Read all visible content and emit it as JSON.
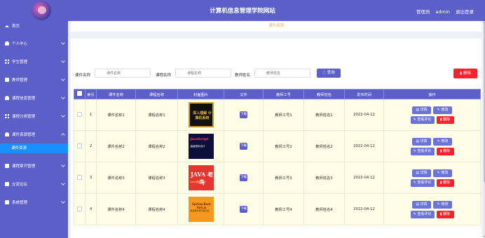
{
  "header": {
    "title": "计算机信息管理学院网站",
    "user_role": "管理员",
    "user_name": "admin",
    "logout": "退出登录"
  },
  "sidebar": {
    "items": [
      {
        "label": "首页",
        "icon": "home-icon"
      },
      {
        "label": "个人中心",
        "icon": "user-icon"
      },
      {
        "label": "学生管理",
        "icon": "grid-icon"
      },
      {
        "label": "教师管理",
        "icon": "box-icon"
      },
      {
        "label": "课程信息管理",
        "icon": "user-icon"
      },
      {
        "label": "课程分类管理",
        "icon": "grid-icon"
      },
      {
        "label": "课件资源管理",
        "icon": "user-icon",
        "expanded": true,
        "children": [
          "课件资源"
        ]
      },
      {
        "label": "课程章节管理",
        "icon": "box-icon"
      },
      {
        "label": "交流论坛",
        "icon": "chat-icon"
      },
      {
        "label": "系统管理",
        "icon": "chat-icon"
      }
    ]
  },
  "breadcrumb": {
    "text": "课件资源"
  },
  "search": {
    "field1_label": "课件名称",
    "field1_placeholder": "课件名称",
    "field2_label": "课程名称",
    "field2_placeholder": "课程名称",
    "field3_label": "教师姓名",
    "field3_placeholder": "教师姓名",
    "search_button": "查询",
    "delete_button": "删除"
  },
  "table": {
    "columns": [
      "索引",
      "课件名称",
      "课程名称",
      "封面图片",
      "文件",
      "教师工号",
      "教师姓名",
      "发布时间",
      "操作"
    ],
    "download_label": "下载",
    "actions": {
      "detail": "详情",
      "edit": "修改",
      "review": "查看评论",
      "delete": "删除"
    },
    "rows": [
      {
        "index": "1",
        "courseware": "课件名称1",
        "course": "课程名称1",
        "teacher_id": "教师工号1",
        "teacher_name": "教师姓名1",
        "date": "2022-04-12",
        "cover_text": "深入理解 计算机系统",
        "cover_sub": ""
      },
      {
        "index": "2",
        "courseware": "课件名称2",
        "course": "课程名称2",
        "teacher_id": "教师工号2",
        "teacher_name": "教师姓名2",
        "date": "2022-04-12",
        "cover_text": "JavaScript",
        "cover_sub": "高级程序设计"
      },
      {
        "index": "3",
        "courseware": "课件名称3",
        "course": "课程名称3",
        "teacher_id": "教师工号3",
        "teacher_name": "教师姓名3",
        "date": "2022-04-12",
        "cover_text": "JAVA 老鸟",
        "cover_sub": "Java 程序设计"
      },
      {
        "index": "4",
        "courseware": "课件名称4",
        "course": "课程名称4",
        "teacher_id": "教师工号4",
        "teacher_name": "教师姓名4",
        "date": "2022-04-12",
        "cover_text": "Spring Boot Vue.js",
        "cover_sub": "前后端分离开发实战"
      }
    ]
  },
  "colors": {
    "primary": "#5b5fc7",
    "danger": "#f5222d",
    "active": "#1890ff",
    "row_bg": "#fffde6"
  }
}
